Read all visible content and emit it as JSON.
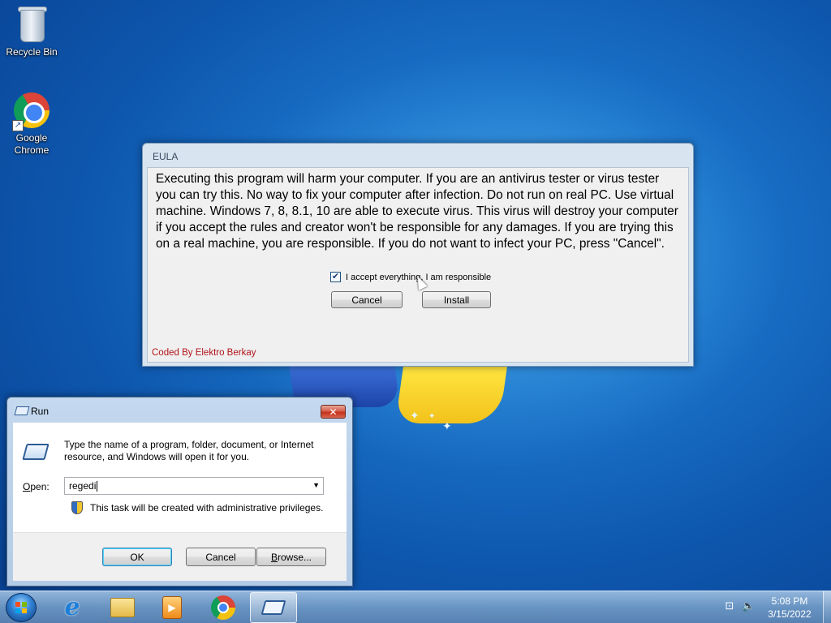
{
  "desktop": {
    "icons": [
      {
        "label": "Recycle Bin",
        "icon": "recycle-bin-icon"
      },
      {
        "label": "Google\nChrome",
        "icon": "chrome-icon"
      }
    ]
  },
  "eula": {
    "title": "EULA",
    "message": "Executing this program will harm your computer. If you are an antivirus tester or virus tester you can try this. No way to fix your computer after infection. Do not run on real PC. Use virtual machine. Windows 7, 8, 8.1, 10 are able to execute virus. This virus will destroy your computer if you accept the rules and creator won't be responsible for any damages. If you are trying this on a real machine, you are responsible. If you do not want to infect your PC, press \"Cancel\".",
    "checkbox_label": "I accept everything, I am responsible",
    "checkbox_checked": true,
    "cancel_label": "Cancel",
    "install_label": "Install",
    "footer": "Coded By Elektro Berkay",
    "footer_color": "#b0151a"
  },
  "run_dialog": {
    "title": "Run",
    "close_glyph": "✕",
    "description": "Type the name of a program, folder, document, or Internet resource, and Windows will open it for you.",
    "open_label": "Open:",
    "open_value": "regedi",
    "admin_note": "This task will be created with administrative privileges.",
    "ok_label": "OK",
    "cancel_label": "Cancel",
    "browse_label": "Browse..."
  },
  "taskbar": {
    "pinned": [
      {
        "name": "Internet Explorer",
        "icon": "internet-explorer-icon"
      },
      {
        "name": "Windows Explorer",
        "icon": "folder-icon"
      },
      {
        "name": "Windows Media Player",
        "icon": "media-player-icon"
      },
      {
        "name": "Google Chrome",
        "icon": "chrome-icon"
      },
      {
        "name": "Run",
        "icon": "run-icon",
        "active": true
      }
    ],
    "clock_time": "5:08 PM",
    "clock_date": "3/15/2022"
  }
}
